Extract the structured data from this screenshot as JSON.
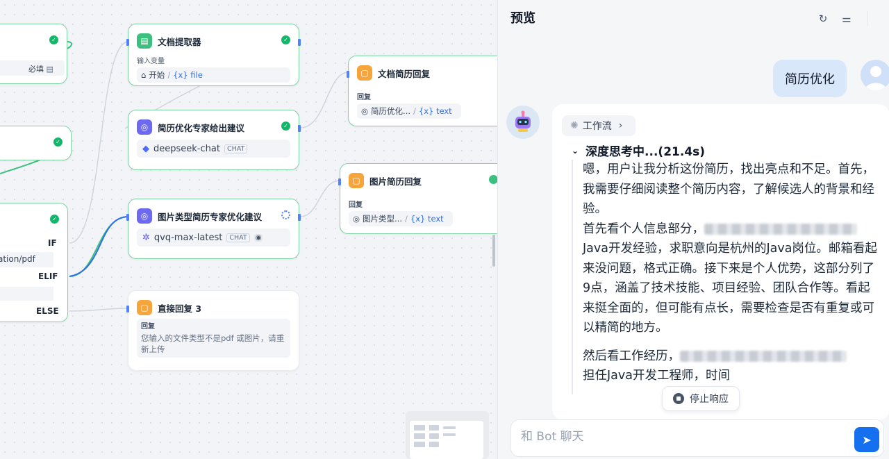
{
  "canvas": {
    "nodes": {
      "left_top": {
        "required_label": "必填"
      },
      "doc_extractor": {
        "title": "文档提取器",
        "input_label": "输入变量",
        "var_source": "开始",
        "var_name": "{x} file"
      },
      "resume_expert": {
        "title": "简历优化专家给出建议",
        "model": "deepseek-chat",
        "model_tag": "CHAT"
      },
      "image_expert": {
        "title": "图片类型简历专家优化建议",
        "model": "qvq-max-latest",
        "model_tag": "CHAT"
      },
      "doc_reply": {
        "title": "文档简历回复",
        "reply_label": "回复",
        "var_source": "简历优化...",
        "var_name": "{x} text"
      },
      "image_reply": {
        "title": "图片简历回复",
        "reply_label": "回复",
        "var_source": "图片类型...",
        "var_name": "{x} text"
      },
      "direct_reply": {
        "title": "直接回复 3",
        "reply_label": "回复",
        "text": "您输入的文件类型不是pdf 或图片，请重新上传"
      },
      "ifelse": {
        "if_label": "IF",
        "elif_label": "ELIF",
        "else_label": "ELSE",
        "condition_text": "ation/pdf"
      }
    }
  },
  "panel": {
    "title": "预览",
    "user_message": "简历优化",
    "workflow_label": "工作流",
    "thinking_title": "深度思考中...(21.4s)",
    "thinking_p1_a": "嗯，用户让我分析这份简历，找出亮点和不足。首先，我需要仔细阅读整个简历内容，了解候选人的背景和经验。",
    "thinking_p1_b": "首先看个人信息部分，",
    "thinking_p1_c": "Java开发经验，求职意向是杭州的Java岗位。邮箱看起来没问题，格式正确。接下来是个人优势，这部分列了9点，涵盖了技术技能、项目经验、团队合作等。看起来挺全面的，但可能有点长，需要检查是否有重复或可以精简的地方。",
    "thinking_p2_a": "然后看工作经历，",
    "thinking_p2_b": "担任Java开发工程师，时间",
    "stop_label": "停止响应",
    "input_placeholder": "和 Bot 聊天"
  },
  "icons": [
    "doc-icon",
    "llm-icon",
    "reply-icon",
    "refresh-icon",
    "settings-icon",
    "send-icon",
    "stop-icon",
    "chevron-right-icon",
    "chevron-down-icon",
    "home-icon",
    "whale-icon",
    "eye-icon"
  ],
  "colors": {
    "accent": "#1570ef",
    "success": "#12b76a",
    "node_border": "#7fd3a5",
    "user_bubble": "#d9e7fb"
  }
}
